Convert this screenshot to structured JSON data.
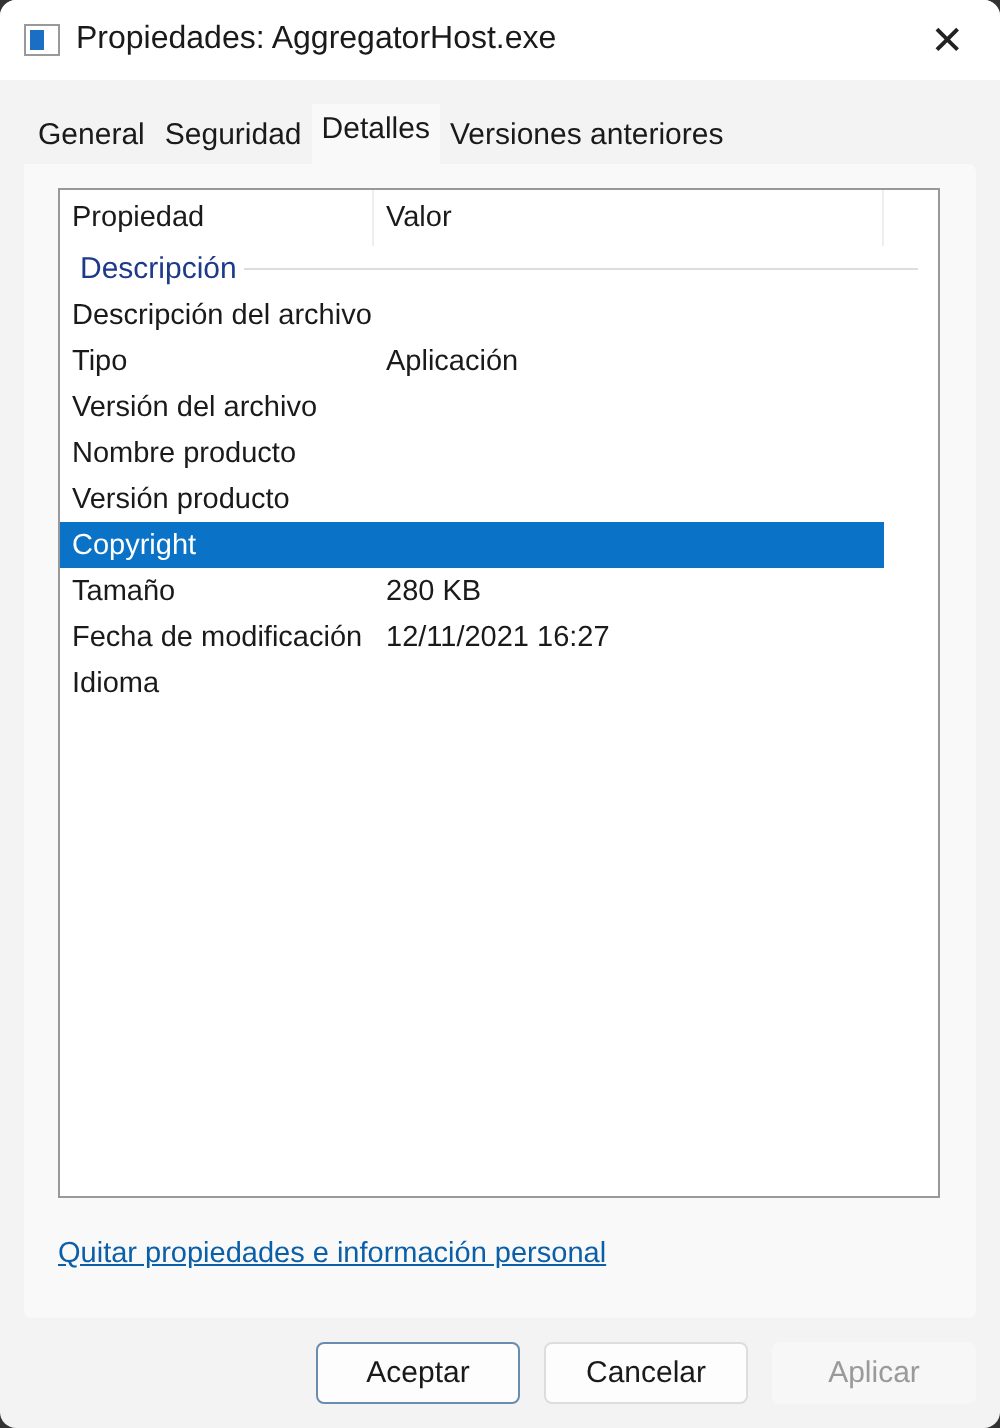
{
  "window": {
    "title": "Propiedades: AggregatorHost.exe",
    "close": "✕"
  },
  "tabs": [
    {
      "label": "General",
      "selected": false
    },
    {
      "label": "Seguridad",
      "selected": false
    },
    {
      "label": "Detalles",
      "selected": true
    },
    {
      "label": "Versiones anteriores",
      "selected": false
    }
  ],
  "table": {
    "columns": [
      "Propiedad",
      "Valor"
    ],
    "rows": [
      {
        "kind": "group",
        "property": "Descripción"
      },
      {
        "kind": "row",
        "property": "Descripción del archivo",
        "selected": false
      },
      {
        "kind": "row",
        "property": "Tipo",
        "value": "Aplicación",
        "selected": false
      },
      {
        "kind": "row",
        "property": "Versión del archivo",
        "selected": false
      },
      {
        "kind": "row",
        "property": "Nombre producto",
        "selected": false
      },
      {
        "kind": "row",
        "property": "Versión producto",
        "selected": false
      },
      {
        "kind": "row",
        "property": "Copyright",
        "selected": true
      },
      {
        "kind": "row",
        "property": "Tamaño",
        "value": "280 KB",
        "selected": false
      },
      {
        "kind": "row",
        "property": "Fecha de modificación",
        "value": "12/11/2021 16:27",
        "selected": false
      },
      {
        "kind": "row",
        "property": "Idioma",
        "selected": false
      }
    ]
  },
  "link": "Quitar propiedades e información personal",
  "buttons": [
    {
      "label": "Aceptar",
      "default": true,
      "disabled": false
    },
    {
      "label": "Cancelar",
      "default": false,
      "disabled": false
    },
    {
      "label": "Aplicar",
      "default": false,
      "disabled": true
    }
  ]
}
